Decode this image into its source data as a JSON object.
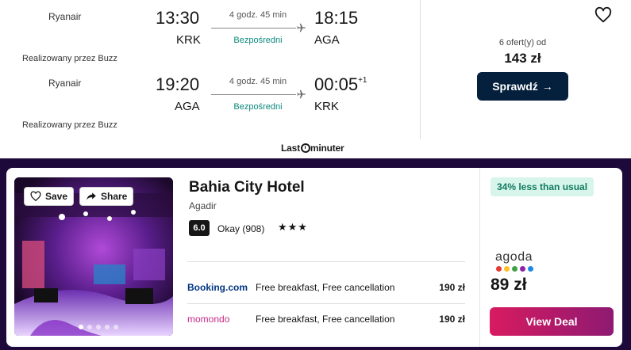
{
  "flight": {
    "outbound": {
      "airline": "Ryanair",
      "dep_time": "13:30",
      "dep_code": "KRK",
      "duration": "4 godz. 45 min",
      "stops": "Bezpośredni",
      "arr_time": "18:15",
      "arr_code": "AGA",
      "operated_by": "Realizowany przez Buzz"
    },
    "inbound": {
      "airline": "Ryanair",
      "dep_time": "19:20",
      "dep_code": "AGA",
      "duration": "4 godz. 45 min",
      "stops": "Bezpośredni",
      "arr_time": "00:05",
      "arr_day_offset": "+1",
      "arr_code": "KRK",
      "operated_by": "Realizowany przez Buzz"
    },
    "offers_text": "6 ofert(y) od",
    "price": "143 zł",
    "check_button": "Sprawdź",
    "partner_logo_a": "Last",
    "partner_logo_b": "minuter"
  },
  "hotel": {
    "save_label": "Save",
    "share_label": "Share",
    "name": "Bahia City Hotel",
    "city": "Agadir",
    "score": "6.0",
    "rating_text": "Okay (908)",
    "stars": "★★★",
    "providers": [
      {
        "logo": "Booking.com",
        "desc": "Free breakfast, Free cancellation",
        "price": "190 zł"
      },
      {
        "logo": "momondo",
        "desc": "Free breakfast, Free cancellation",
        "price": "190 zł"
      }
    ],
    "deal_badge": "34% less than usual",
    "best_provider": "agoda",
    "best_price": "89 zł",
    "view_deal": "View Deal",
    "photo_count": 5,
    "active_photo": 1
  },
  "colors": {
    "navy_button": "#05203c",
    "direct_green": "#0c8a7d",
    "band": "#1d0a3a",
    "badge_bg": "#d8f5ec",
    "badge_text": "#107b5e",
    "deal_start": "#d81b60",
    "deal_end": "#8e1a72",
    "booking_blue": "#003580"
  }
}
